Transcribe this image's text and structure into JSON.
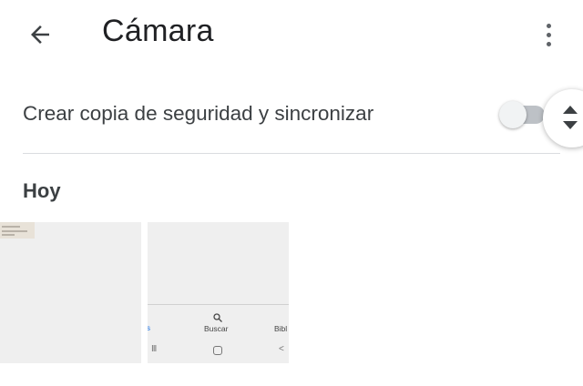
{
  "header": {
    "title": "Cámara",
    "back_icon": "arrow-back-icon",
    "more_icon": "more-vert-icon"
  },
  "backup": {
    "label": "Crear copia de seguridad y sincronizar",
    "enabled": false
  },
  "sections": [
    {
      "header": "Hoy",
      "thumbnails": [
        {
          "kind": "screenshot"
        },
        {
          "kind": "screenshot",
          "nav_left": "s",
          "nav_center": "Buscar",
          "nav_right": "Bibl",
          "system_recents": "III",
          "system_back": "<"
        }
      ]
    }
  ],
  "colors": {
    "text_primary": "#202124",
    "toggle_off_track": "#bdc1c6",
    "divider": "#dadce0",
    "thumbnail_bg": "#efefef",
    "accent": "#1a73e8"
  }
}
